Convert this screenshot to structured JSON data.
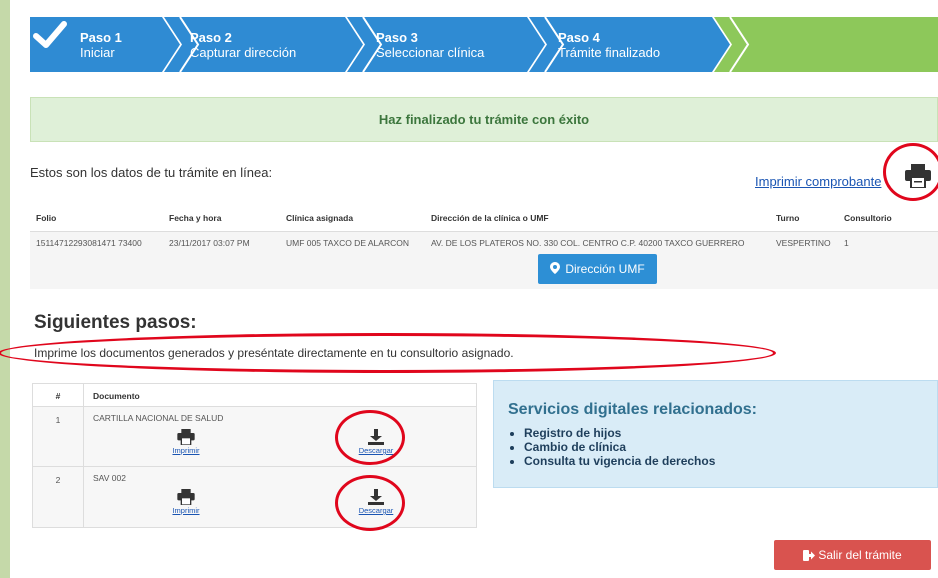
{
  "steps": [
    {
      "title": "Paso 1",
      "subtitle": "Iniciar"
    },
    {
      "title": "Paso 2",
      "subtitle": "Capturar dirección"
    },
    {
      "title": "Paso 3",
      "subtitle": "Seleccionar clínica"
    },
    {
      "title": "Paso 4",
      "subtitle": "Trámite finalizado"
    }
  ],
  "colors": {
    "step_blue": "#2f8bd3",
    "step_green": "#8dc85a",
    "danger": "#d9534f",
    "annotation": "#e0061c"
  },
  "success_message": "Haz finalizado tu trámite con éxito",
  "intro_text": "Estos son los datos de tu trámite en línea:",
  "print_receipt_label": "Imprimir comprobante",
  "table": {
    "headers": [
      "Folio",
      "Fecha y hora",
      "Clínica asignada",
      "Dirección de la clínica o UMF",
      "Turno",
      "Consultorio"
    ],
    "row": [
      "15114712293081471 73400",
      "23/11/2017 03:07 PM",
      "UMF 005 TAXCO DE ALARCON",
      "AV. DE LOS PLATEROS NO. 330 COL. CENTRO C.P. 40200 TAXCO GUERRERO",
      "VESPERTINO",
      "1"
    ],
    "umf_button": "Dirección UMF"
  },
  "next_steps": {
    "title": "Siguientes pasos:",
    "description": "Imprime los documentos generados y preséntate directamente en tu consultorio asignado."
  },
  "documents": {
    "headers": [
      "#",
      "Documento"
    ],
    "rows": [
      {
        "num": "1",
        "name": "CARTILLA NACIONAL DE SALUD",
        "print": "Imprimir",
        "download": "Descargar"
      },
      {
        "num": "2",
        "name": "SAV 002",
        "print": "Imprimir",
        "download": "Descargar"
      }
    ]
  },
  "services": {
    "title": "Servicios digitales relacionados:",
    "items": [
      "Registro de hijos",
      "Cambio de clínica",
      "Consulta tu vigencia de derechos"
    ]
  },
  "exit_label": "Salir del trámite",
  "icons": [
    "check-icon",
    "printer-icon",
    "map-pin-icon",
    "download-icon",
    "exit-icon"
  ]
}
